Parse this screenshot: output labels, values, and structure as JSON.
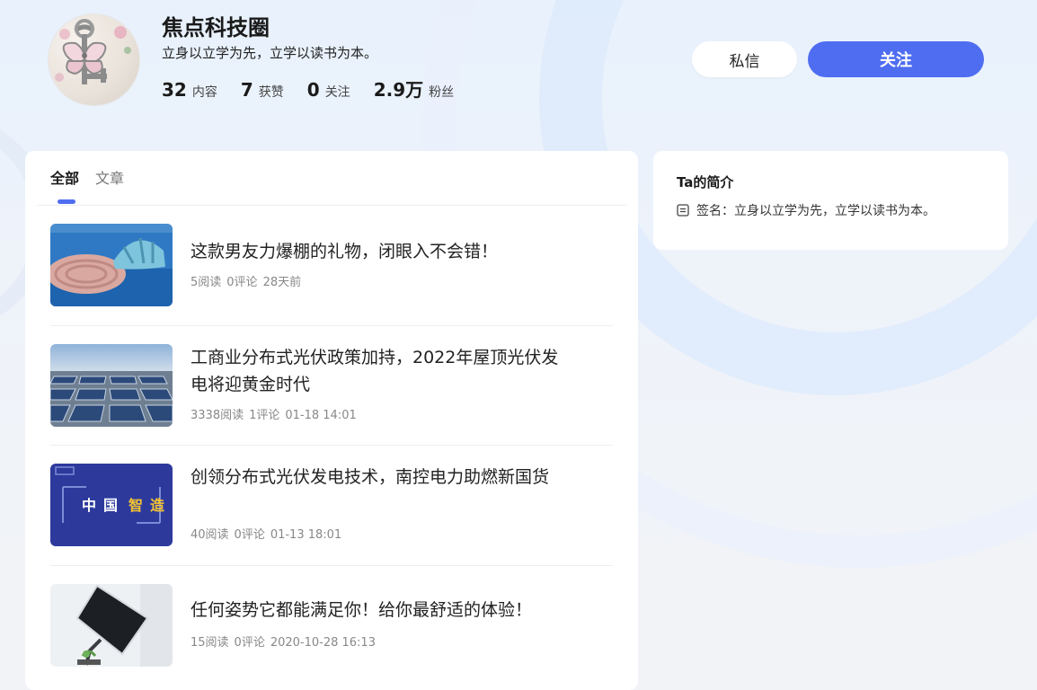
{
  "profile": {
    "name": "焦点科技圈",
    "motto": "立身以立学为先，立学以读书为本。",
    "stats": [
      {
        "value": "32",
        "label": "内容"
      },
      {
        "value": "7",
        "label": "获赞"
      },
      {
        "value": "0",
        "label": "关注"
      },
      {
        "value": "2.9万",
        "label": "粉丝"
      }
    ]
  },
  "actions": {
    "message_label": "私信",
    "follow_label": "关注"
  },
  "tabs": [
    {
      "label": "全部",
      "active": true
    },
    {
      "label": "文章",
      "active": false
    }
  ],
  "articles": [
    {
      "title": "这款男友力爆棚的礼物，闭眼入不会错！",
      "reads": "5阅读",
      "comments": "0评论",
      "time": "28天前",
      "thumb_icon": "helmet-rope-photo"
    },
    {
      "title": "工商业分布式光伏政策加持，2022年屋顶光伏发电将迎黄金时代",
      "reads": "3338阅读",
      "comments": "1评论",
      "time": "01-18 14:01",
      "thumb_icon": "solar-panels-photo"
    },
    {
      "title": "创领分布式光伏发电技术，南控电力助燃新国货",
      "reads": "40阅读",
      "comments": "0评论",
      "time": "01-13 18:01",
      "thumb_icon": "made-in-china-banner",
      "thumb_text": [
        "中",
        "国",
        "智",
        "造"
      ]
    },
    {
      "title": "任何姿势它都能满足你！给你最舒适的体验！",
      "reads": "15阅读",
      "comments": "0评论",
      "time": "2020-10-28 16:13",
      "thumb_icon": "monitor-arm-photo"
    }
  ],
  "intro": {
    "title": "Ta的简介",
    "signature": "签名：立身以立学为先，立学以读书为本。"
  },
  "colors": {
    "accent": "#4f6df0",
    "text": "#222222",
    "muted": "#888888"
  }
}
